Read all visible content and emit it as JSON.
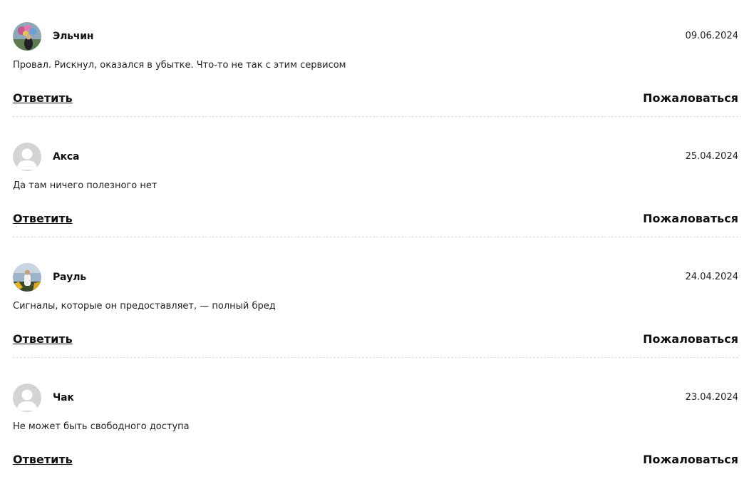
{
  "comments": [
    {
      "author": "Эльчин",
      "date": "09.06.2024",
      "text": "Провал. Рискнул, оказался в убытке. Что-то не так с этим сервисом",
      "reply_label": "Ответить",
      "report_label": "Пожаловаться",
      "avatar": "photo-avatar"
    },
    {
      "author": "Акса",
      "date": "25.04.2024",
      "text": "Да там ничего полезного нет",
      "reply_label": "Ответить",
      "report_label": "Пожаловаться",
      "avatar": "default-user-avatar"
    },
    {
      "author": "Рауль",
      "date": "24.04.2024",
      "text": "Сигналы, которые он предоставляет, — полный бред",
      "reply_label": "Ответить",
      "report_label": "Пожаловаться",
      "avatar": "photo-avatar"
    },
    {
      "author": "Чак",
      "date": "23.04.2024",
      "text": "Не может быть свободного доступа",
      "reply_label": "Ответить",
      "report_label": "Пожаловаться",
      "avatar": "default-user-avatar"
    }
  ],
  "colors": {
    "text": "#111111",
    "divider": "#dcdcdc",
    "default_avatar_bg": "#d4d4d4"
  }
}
